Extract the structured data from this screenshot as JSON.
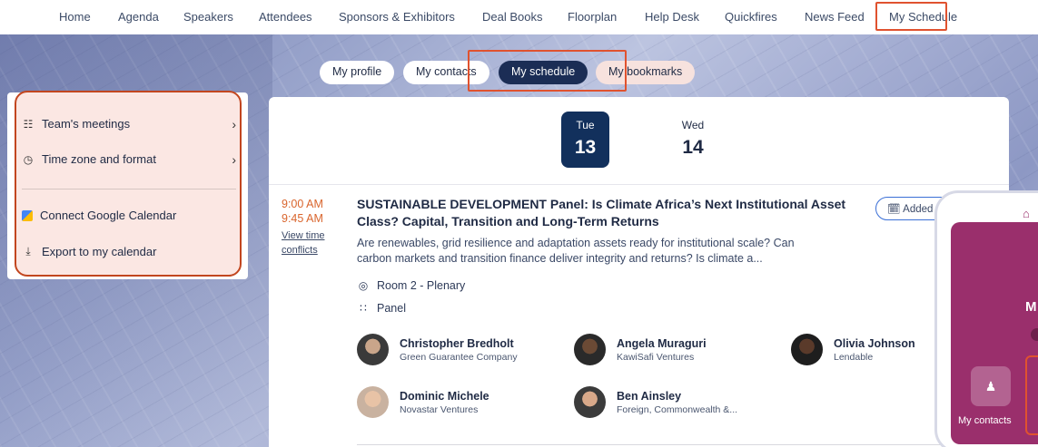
{
  "nav": {
    "items": [
      "Home",
      "Agenda",
      "Speakers",
      "Attendees",
      "Sponsors & Exhibitors",
      "Deal Books",
      "Floorplan",
      "Help Desk",
      "Quickfires",
      "News Feed",
      "My Schedule"
    ]
  },
  "subtabs": {
    "profile": "My profile",
    "contacts": "My contacts",
    "schedule": "My schedule",
    "bookmarks": "My bookmarks"
  },
  "sidemenu": {
    "teams_meetings": "Team's meetings",
    "timezone": "Time zone and format",
    "google": "Connect Google Calendar",
    "export": "Export to my calendar"
  },
  "days": [
    {
      "dow": "Tue",
      "num": "13"
    },
    {
      "dow": "Wed",
      "num": "14"
    }
  ],
  "session": {
    "start": "9:00 AM",
    "end": "9:45 AM",
    "conflicts": "View time conflicts",
    "title": "SUSTAINABLE DEVELOPMENT Panel: Is Climate Africa’s Next Institutional Asset Class? Capital, Transition and Long-Term Returns",
    "description": "Are renewables, grid resilience and adaptation assets ready for institutional scale? Can carbon markets and transition finance deliver integrity and returns? Is climate a...",
    "room": "Room 2 - Plenary",
    "format": "Panel",
    "added_label": "Added to s"
  },
  "speakers": [
    {
      "name": "Christopher Bredholt",
      "org": "Green Guarantee Company"
    },
    {
      "name": "Angela Muraguri",
      "org": "KawiSafi Ventures"
    },
    {
      "name": "Olivia Johnson",
      "org": "Lendable"
    },
    {
      "name": "Dominic Michele",
      "org": "Novastar Ventures"
    },
    {
      "name": "Ben Ainsley",
      "org": "Foreign, Commonwealth &..."
    }
  ],
  "phone": {
    "letter": "M",
    "tile_label": "My contacts"
  },
  "colors": {
    "accent": "#e0522f",
    "navy": "#12305c",
    "time": "#d9652d",
    "phone": "#9a2f6c"
  }
}
